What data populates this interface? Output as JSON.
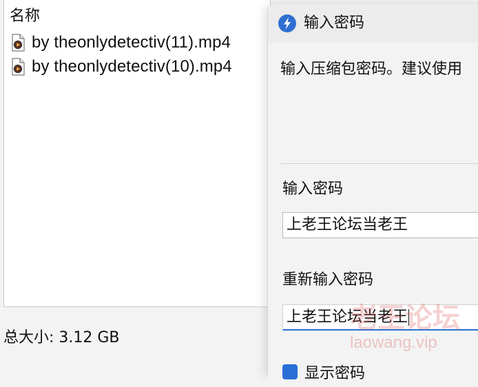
{
  "file_list": {
    "column_header": "名称",
    "items": [
      {
        "name": "by theonlydetectiv(11).mp4",
        "icon": "video-file-icon"
      },
      {
        "name": "by theonlydetectiv(10).mp4",
        "icon": "video-file-icon"
      }
    ]
  },
  "footer": {
    "total_size": "总大小: 3.12 GB"
  },
  "dialog": {
    "icon": "winrar-bolt-icon",
    "title": "输入密码",
    "description": "输入压缩包密码。建议使用",
    "password_label": "输入密码",
    "password_value": "上老王论坛当老王",
    "reenter_label": "重新输入密码",
    "reenter_value": "上老王论坛当老王",
    "show_password_label": "显示密码"
  },
  "watermark": {
    "text": "老王论坛",
    "url": "laowang.vip"
  },
  "colors": {
    "accent": "#2f6fd1",
    "checkbox": "#2a6fd6",
    "watermark": "#da5a5a"
  }
}
